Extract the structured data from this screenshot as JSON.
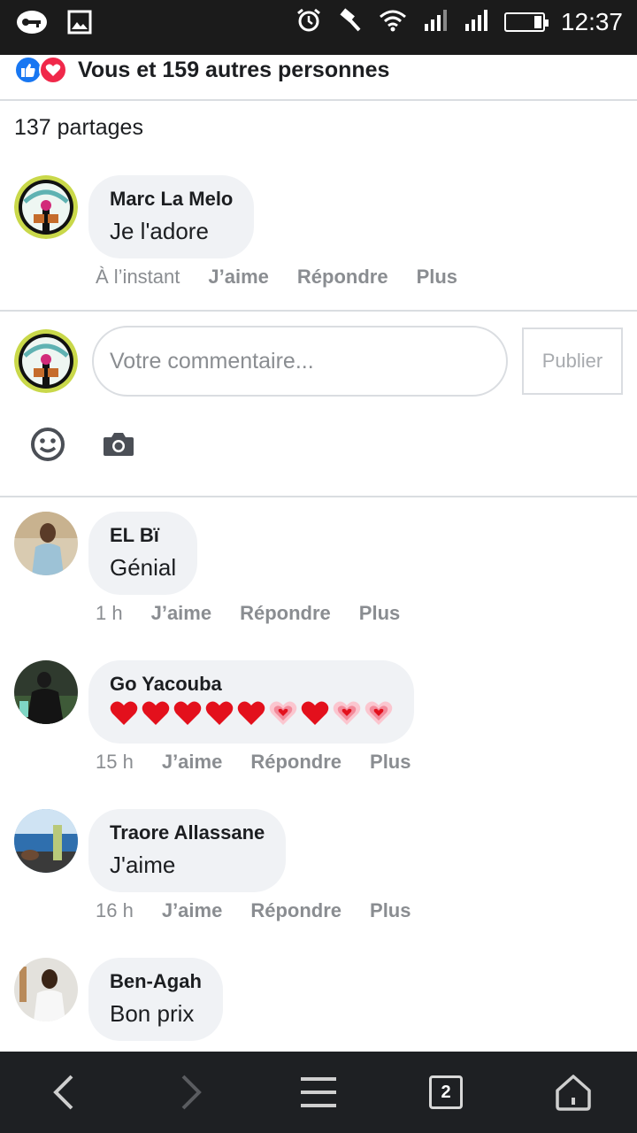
{
  "status_bar": {
    "time": "12:37",
    "left_icons": [
      "key-icon",
      "image-icon"
    ],
    "right_icons": [
      "alarm-icon",
      "hammer-icon",
      "wifi-icon",
      "signal-icon",
      "signal-icon",
      "battery-icon"
    ]
  },
  "reactions": {
    "icons": [
      "like-icon",
      "love-icon"
    ],
    "text": "Vous et 159 autres personnes"
  },
  "shares": "137 partages",
  "pinned_comment": {
    "author": "Marc La Melo",
    "text": "Je l'adore",
    "time": "À l’instant",
    "like_label": "J’aime",
    "reply_label": "Répondre",
    "more_label": "Plus"
  },
  "composer": {
    "placeholder": "Votre commentaire...",
    "publish_label": "Publier",
    "tool_icons": [
      "emoji-icon",
      "camera-icon"
    ]
  },
  "comments": [
    {
      "author": "EL Bï",
      "text": "Génial",
      "time": "1 h",
      "like_label": "J’aime",
      "reply_label": "Répondre",
      "more_label": "Plus"
    },
    {
      "author": "Go Yacouba",
      "text": "",
      "emoji_sequence": [
        "red-heart",
        "red-heart",
        "red-heart",
        "red-heart",
        "red-heart",
        "growing-heart",
        "red-heart",
        "growing-heart",
        "growing-heart"
      ],
      "time": "15 h",
      "like_label": "J’aime",
      "reply_label": "Répondre",
      "more_label": "Plus"
    },
    {
      "author": "Traore Allassane",
      "text": "J'aime",
      "time": "16 h",
      "like_label": "J’aime",
      "reply_label": "Répondre",
      "more_label": "Plus"
    },
    {
      "author": "Ben-Agah",
      "text": "Bon prix"
    }
  ],
  "nav_bar": {
    "tabs_count": "2",
    "icons": [
      "back-icon",
      "forward-icon",
      "menu-icon",
      "tabs-icon",
      "home-icon"
    ]
  },
  "colors": {
    "status_bar_bg": "#1b1b1b",
    "like_blue": "#1877f2",
    "love_red": "#f0284a",
    "bubble_bg": "#f0f2f5",
    "meta_gray": "#8a8d91",
    "nav_bg": "#1e2023"
  }
}
